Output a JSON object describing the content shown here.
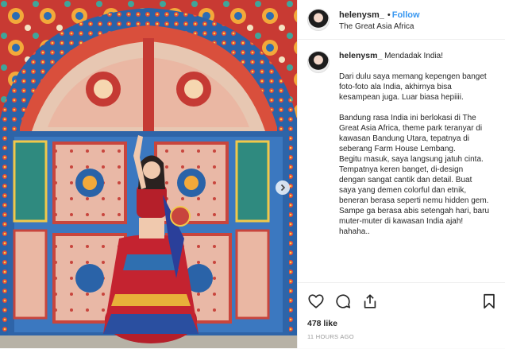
{
  "header": {
    "username": "helenysm_",
    "separator": "•",
    "follow_label": "Follow",
    "location": "The Great Asia Africa"
  },
  "caption": {
    "username": "helenysm_",
    "title": "Mendadak India!",
    "paragraph1": "Dari dulu saya memang kepengen banget foto-foto ala India, akhirnya bisa kesampean juga. Luar biasa hepiiii.",
    "paragraph2": "Bandung rasa India ini berlokasi di The Great Asia Africa, theme park teranyar di kawasan Bandung Utara, tepatnya di seberang Farm House Lembang.",
    "paragraph3": "Begitu masuk, saya langsung jatuh cinta. Tempatnya keren banget, di-design dengan sangat cantik dan detail. Buat saya yang demen colorful dan etnik, beneran berasa seperti nemu hidden gem. Sampe ga berasa abis setengah hari, baru muter-muter di kawasan India ajah! hahaha.."
  },
  "actions": {
    "likes": "478 like",
    "timestamp": "11 HOURS AGO"
  },
  "icons": {
    "like": "heart-icon",
    "comment": "comment-icon",
    "share": "share-icon",
    "save": "bookmark-icon",
    "next": "chevron-right-icon"
  },
  "colors": {
    "follow": "#3897f0",
    "text": "#262626",
    "muted": "#999999"
  }
}
